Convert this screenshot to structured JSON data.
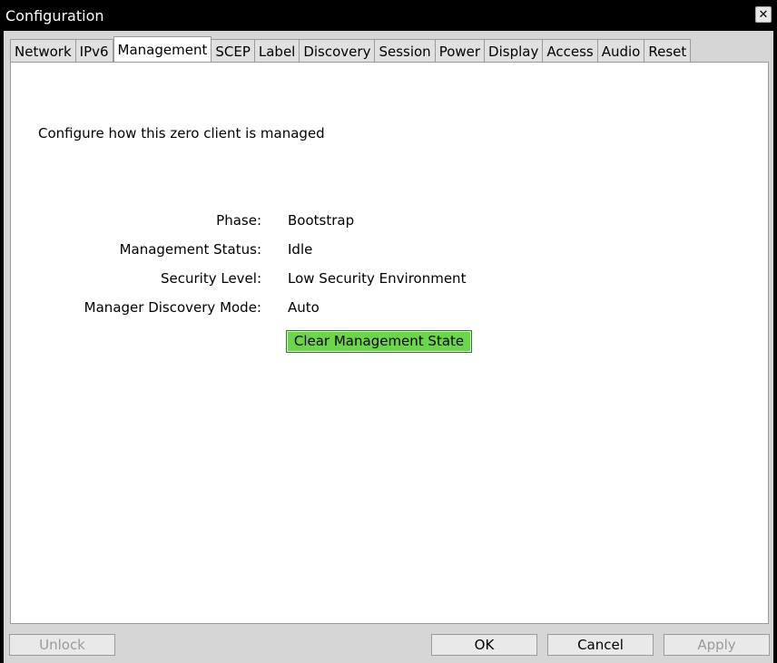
{
  "window": {
    "title": "Configuration",
    "close_glyph": "✕"
  },
  "tabs": [
    {
      "label": "Network"
    },
    {
      "label": "IPv6"
    },
    {
      "label": "Management",
      "active": true
    },
    {
      "label": "SCEP"
    },
    {
      "label": "Label"
    },
    {
      "label": "Discovery"
    },
    {
      "label": "Session"
    },
    {
      "label": "Power"
    },
    {
      "label": "Display"
    },
    {
      "label": "Access"
    },
    {
      "label": "Audio"
    },
    {
      "label": "Reset"
    }
  ],
  "management": {
    "description": "Configure how this zero client is managed",
    "fields": [
      {
        "label": "Phase:",
        "value": "Bootstrap"
      },
      {
        "label": "Management Status:",
        "value": "Idle"
      },
      {
        "label": "Security Level:",
        "value": "Low Security Environment"
      },
      {
        "label": "Manager Discovery Mode:",
        "value": "Auto"
      }
    ],
    "clear_button": "Clear Management State"
  },
  "footer": {
    "unlock": "Unlock",
    "ok": "OK",
    "cancel": "Cancel",
    "apply": "Apply"
  },
  "colors": {
    "accent_button": "#6bd64a"
  }
}
